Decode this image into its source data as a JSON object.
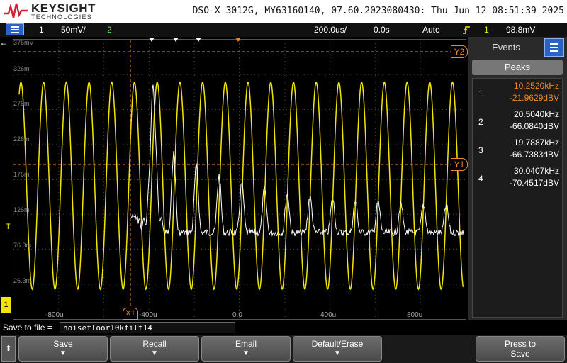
{
  "header": {
    "brand_name": "KEYSIGHT",
    "brand_sub": "TECHNOLOGIES",
    "title": "DSO-X 3012G, MY63160140, 07.60.2023080430: Thu Jun 12 08:51:39 2025",
    "brand_color": "#d12030"
  },
  "status": {
    "ch1_label": "1",
    "ch1_scale": "50mV/",
    "ch2_label": "2",
    "timebase": "200.0us/",
    "delay": "0.0s",
    "trigger_mode": "Auto",
    "trigger_icon": "rising-edge-icon",
    "trigger_source": "1",
    "trigger_level": "98.8mV"
  },
  "grid": {
    "y_labels": [
      "376mV",
      "326m",
      "276m",
      "226m",
      "176m",
      "126m",
      "76.3m",
      "26.3m"
    ],
    "x_labels": [
      "-800u",
      "-400u",
      "0.0",
      "400u",
      "800u"
    ],
    "markers": {
      "y2": "Y2",
      "y1": "Y1",
      "x1": "X1",
      "trigger": "T",
      "ch1": "1"
    },
    "colors": {
      "ch1": "#f2e600",
      "math": "#ffffff",
      "cursor": "#f08a24"
    }
  },
  "events": {
    "tab_label": "Events",
    "peaks_label": "Peaks",
    "peaks": [
      {
        "index": "1",
        "freq": "10.2520kHz",
        "mag": "-21.9629dBV",
        "highlight": true
      },
      {
        "index": "2",
        "freq": "20.5040kHz",
        "mag": "-66.0840dBV",
        "highlight": false
      },
      {
        "index": "3",
        "freq": "19.7887kHz",
        "mag": "-66.7383dBV",
        "highlight": false
      },
      {
        "index": "4",
        "freq": "30.0407kHz",
        "mag": "-70.4517dBV",
        "highlight": false
      }
    ]
  },
  "save": {
    "label": "Save to file =",
    "filename": "noisefloor10kfilt14"
  },
  "softkeys": {
    "up": "⬆",
    "save": "Save",
    "recall": "Recall",
    "email": "Email",
    "default_erase": "Default/Erase",
    "press_to": "Press to",
    "press_save": "Save"
  }
}
